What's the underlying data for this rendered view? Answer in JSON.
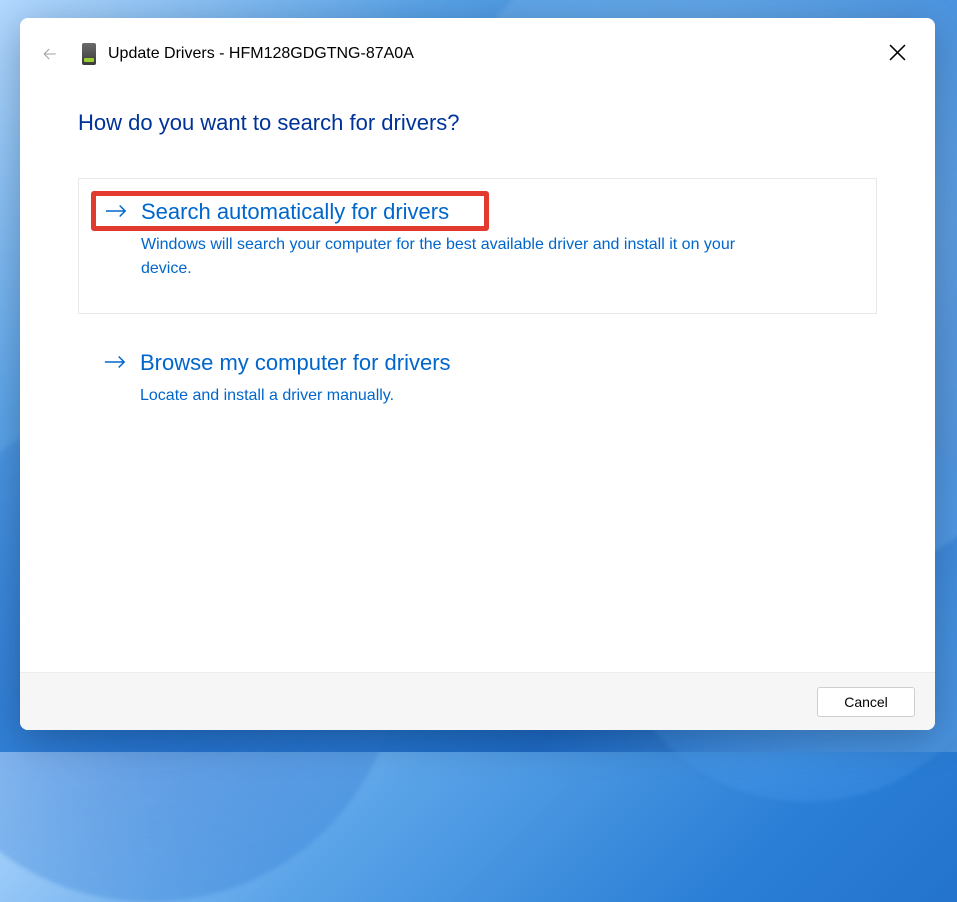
{
  "dialog": {
    "title": "Update Drivers - HFM128GDGTNG-87A0A",
    "heading": "How do you want to search for drivers?"
  },
  "options": [
    {
      "title": "Search automatically for drivers",
      "description": "Windows will search your computer for the best available driver and install it on your device."
    },
    {
      "title": "Browse my computer for drivers",
      "description": "Locate and install a driver manually."
    }
  ],
  "footer": {
    "cancel_label": "Cancel"
  }
}
